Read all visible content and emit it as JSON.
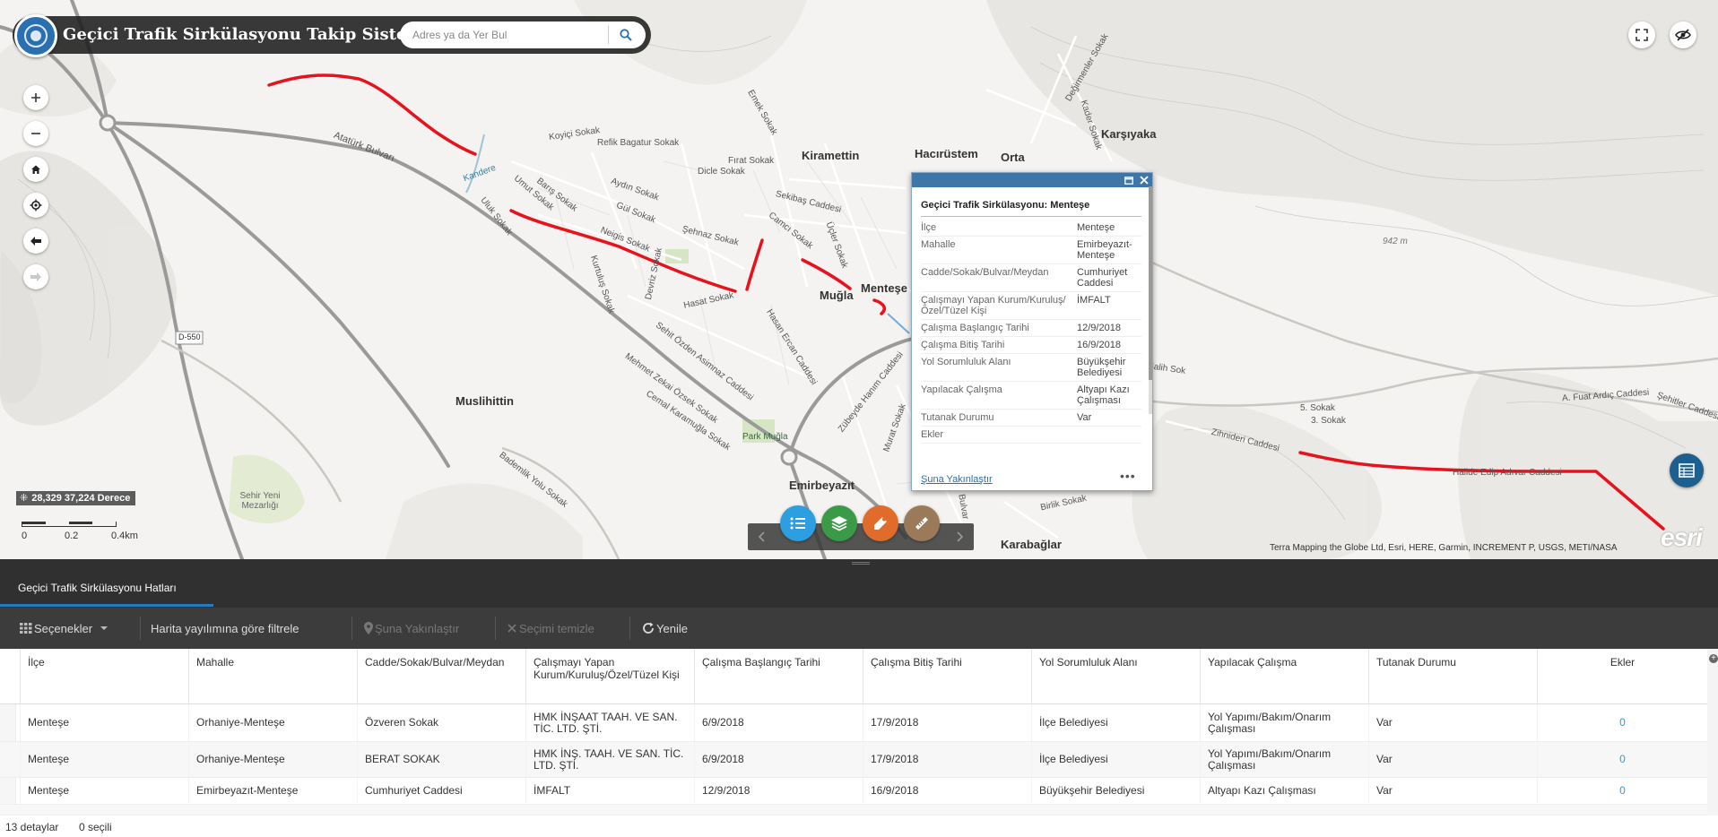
{
  "app": {
    "title": "Geçici Trafik Sirkülasyonu Takip Sistemi",
    "search_placeholder": "Adres ya da Yer Bul"
  },
  "map": {
    "coordinate_readout": "28,329 37,224 Derece",
    "scale": {
      "labels": [
        "0",
        "0.2",
        "0.4km"
      ]
    },
    "attribution": "Terra Mapping the Globe Ltd, Esri, HERE, Garmin, INCREMENT P, USGS, METI/NASA",
    "esri_logo": "esri",
    "towns": [
      {
        "name": "Kiramettin"
      },
      {
        "name": "Hacırüstem"
      },
      {
        "name": "Orta"
      },
      {
        "name": "Karşıyaka"
      },
      {
        "name": "Muğla"
      },
      {
        "name": "Menteşe"
      },
      {
        "name": "Muslihittin"
      },
      {
        "name": "Emirbeyazıt"
      },
      {
        "name": "Karabağlar"
      }
    ],
    "streets": [
      {
        "name": "Atatürk Bulvarı"
      },
      {
        "name": "Kandere"
      },
      {
        "name": "Koyiçi Sokak"
      },
      {
        "name": "Refik Bagatur Sokak"
      },
      {
        "name": "Fırat Sokak"
      },
      {
        "name": "Dicle Sokak"
      },
      {
        "name": "Aydın Sokak"
      },
      {
        "name": "Gül Sokak"
      },
      {
        "name": "Şehnaz Sokak"
      },
      {
        "name": "Neigis Sokak"
      },
      {
        "name": "Hasat Sokak"
      },
      {
        "name": "Sekibaş Caddesi"
      },
      {
        "name": "Camcı Sokak"
      },
      {
        "name": "Emek Sokak"
      },
      {
        "name": "Üçler Sokak"
      },
      {
        "name": "Kurtuluş Sokak"
      },
      {
        "name": "Devriz Sokak"
      },
      {
        "name": "Hasan Ercan Caddesi"
      },
      {
        "name": "Sehit Özden Asimnaz Caddesi"
      },
      {
        "name": "Mehmet Zekai Özsek Sokak"
      },
      {
        "name": "Cemal Karamuğla Sokak"
      },
      {
        "name": "Zübeyde Hanım Caddesi"
      },
      {
        "name": "Bademlik Yolu Sokak"
      },
      {
        "name": "Uluk Sokak"
      },
      {
        "name": "Umut Sokak"
      },
      {
        "name": "Barış Sokak"
      },
      {
        "name": "A. Fuat Ardıç Caddesi"
      },
      {
        "name": "Zihnideri Caddesi"
      },
      {
        "name": "Birlik Sokak"
      },
      {
        "name": "Murat Sokak"
      },
      {
        "name": "Bulvar"
      },
      {
        "name": "Park Muğla"
      },
      {
        "name": "Sehir Yeni Mezarlığı"
      },
      {
        "name": "D-550"
      },
      {
        "name": "942 m"
      },
      {
        "name": "Değirmenler Sokak"
      },
      {
        "name": "Kader Sokak"
      },
      {
        "name": "5. Sokak"
      },
      {
        "name": "3. Sokak"
      },
      {
        "name": "Şehitler Caddesi"
      },
      {
        "name": "Halide Edip Adıvar Caddesi"
      },
      {
        "name": "Salih Sok"
      }
    ]
  },
  "popup": {
    "title": "Geçici Trafik Sirkülasyonu: Menteşe",
    "rows": [
      {
        "k": "İlçe",
        "v": "Menteşe"
      },
      {
        "k": "Mahalle",
        "v": "Emirbeyazıt-Menteşe"
      },
      {
        "k": "Cadde/Sokak/Bulvar/Meydan",
        "v": "Cumhuriyet Caddesi"
      },
      {
        "k": "Çalışmayı Yapan Kurum/Kuruluş/Özel/Tüzel Kişi",
        "v": "İMFALT"
      },
      {
        "k": "Çalışma Başlangıç Tarihi",
        "v": "12/9/2018"
      },
      {
        "k": "Çalışma Bitiş Tarihi",
        "v": "16/9/2018"
      },
      {
        "k": "Yol Sorumluluk Alanı",
        "v": "Büyükşehir Belediyesi"
      },
      {
        "k": "Yapılacak Çalışma",
        "v": "Altyapı Kazı Çalışması"
      },
      {
        "k": "Tutanak Durumu",
        "v": "Var"
      },
      {
        "k": "Ekler",
        "v": ""
      }
    ],
    "zoom_link": "Şuna Yakınlaştır",
    "more": "•••"
  },
  "panel": {
    "tab": "Geçici Trafik Sirkülasyonu Hatları",
    "tools": {
      "options": "Seçenekler",
      "filter": "Harita yayılımına göre filtrele",
      "zoom": "Şuna Yakınlaştır",
      "clear": "Seçimi temizle",
      "refresh": "Yenile"
    },
    "columns": [
      "İlçe",
      "Mahalle",
      "Cadde/Sokak/Bulvar/Meydan",
      "Çalışmayı Yapan Kurum/Kuruluş/Özel/Tüzel Kişi",
      "Çalışma Başlangıç Tarihi",
      "Çalışma Bitiş Tarihi",
      "Yol Sorumluluk Alanı",
      "Yapılacak Çalışma",
      "Tutanak Durumu",
      "Ekler"
    ],
    "rows": [
      [
        "Menteşe",
        "Orhaniye-Menteşe",
        "Özveren Sokak",
        "HMK İNŞAAT TAAH. VE SAN. TİC. LTD. ŞTİ.",
        "6/9/2018",
        "17/9/2018",
        "İlçe Belediyesi",
        "Yol Yapımı/Bakım/Onarım Çalışması",
        "Var",
        "0"
      ],
      [
        "Menteşe",
        "Orhaniye-Menteşe",
        "BERAT SOKAK",
        "HMK İNŞ. TAAH. VE SAN. TİC. LTD. ŞTİ.",
        "6/9/2018",
        "17/9/2018",
        "İlçe Belediyesi",
        "Yol Yapımı/Bakım/Onarım Çalışması",
        "Var",
        "0"
      ],
      [
        "Menteşe",
        "Emirbeyazıt-Menteşe",
        "Cumhuriyet Caddesi",
        "İMFALT",
        "12/9/2018",
        "16/9/2018",
        "Büyükşehir Belediyesi",
        "Altyapı Kazı Çalışması",
        "Var",
        "0"
      ]
    ],
    "footer_details": "13 detaylar",
    "footer_selected": "0 seçili"
  },
  "colors": {
    "route": "#e8121c",
    "header": "#1e1e1e",
    "panel": "#303030",
    "accent": "#1f7dc3",
    "tool_list": "#2d9ee0",
    "tool_layers": "#3a9a47",
    "tool_draw": "#e06b2a",
    "tool_measure": "#9b7a5a"
  },
  "icons": {
    "search": "search-icon",
    "fullscreen": "fullscreen-icon",
    "hide": "eye-off-icon",
    "zoom_in": "plus-icon",
    "zoom_out": "minus-icon",
    "home": "home-icon",
    "locate": "locate-icon",
    "back": "arrow-left-icon",
    "forward": "arrow-right-icon",
    "table": "table-icon",
    "list": "list-icon",
    "layers": "layers-icon",
    "draw": "draw-icon",
    "measure": "ruler-icon"
  }
}
